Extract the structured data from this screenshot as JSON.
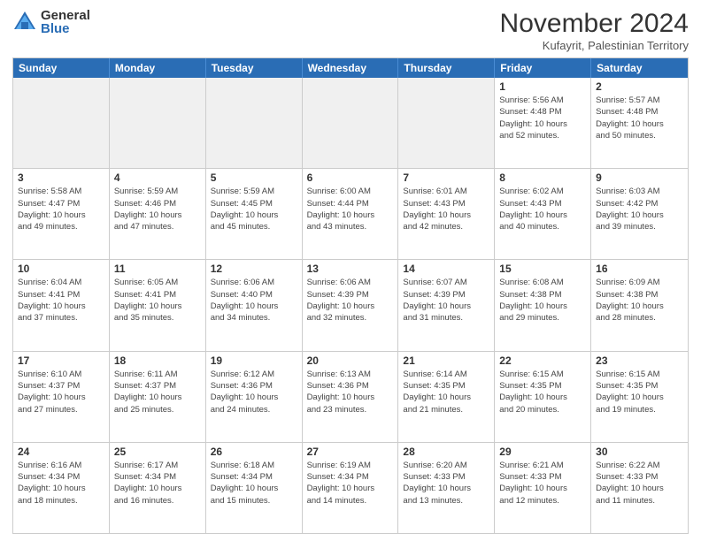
{
  "logo": {
    "general": "General",
    "blue": "Blue"
  },
  "header": {
    "month": "November 2024",
    "location": "Kufayrit, Palestinian Territory"
  },
  "weekdays": [
    "Sunday",
    "Monday",
    "Tuesday",
    "Wednesday",
    "Thursday",
    "Friday",
    "Saturday"
  ],
  "rows": [
    [
      {
        "day": "",
        "info": ""
      },
      {
        "day": "",
        "info": ""
      },
      {
        "day": "",
        "info": ""
      },
      {
        "day": "",
        "info": ""
      },
      {
        "day": "",
        "info": ""
      },
      {
        "day": "1",
        "info": "Sunrise: 5:56 AM\nSunset: 4:48 PM\nDaylight: 10 hours\nand 52 minutes."
      },
      {
        "day": "2",
        "info": "Sunrise: 5:57 AM\nSunset: 4:48 PM\nDaylight: 10 hours\nand 50 minutes."
      }
    ],
    [
      {
        "day": "3",
        "info": "Sunrise: 5:58 AM\nSunset: 4:47 PM\nDaylight: 10 hours\nand 49 minutes."
      },
      {
        "day": "4",
        "info": "Sunrise: 5:59 AM\nSunset: 4:46 PM\nDaylight: 10 hours\nand 47 minutes."
      },
      {
        "day": "5",
        "info": "Sunrise: 5:59 AM\nSunset: 4:45 PM\nDaylight: 10 hours\nand 45 minutes."
      },
      {
        "day": "6",
        "info": "Sunrise: 6:00 AM\nSunset: 4:44 PM\nDaylight: 10 hours\nand 43 minutes."
      },
      {
        "day": "7",
        "info": "Sunrise: 6:01 AM\nSunset: 4:43 PM\nDaylight: 10 hours\nand 42 minutes."
      },
      {
        "day": "8",
        "info": "Sunrise: 6:02 AM\nSunset: 4:43 PM\nDaylight: 10 hours\nand 40 minutes."
      },
      {
        "day": "9",
        "info": "Sunrise: 6:03 AM\nSunset: 4:42 PM\nDaylight: 10 hours\nand 39 minutes."
      }
    ],
    [
      {
        "day": "10",
        "info": "Sunrise: 6:04 AM\nSunset: 4:41 PM\nDaylight: 10 hours\nand 37 minutes."
      },
      {
        "day": "11",
        "info": "Sunrise: 6:05 AM\nSunset: 4:41 PM\nDaylight: 10 hours\nand 35 minutes."
      },
      {
        "day": "12",
        "info": "Sunrise: 6:06 AM\nSunset: 4:40 PM\nDaylight: 10 hours\nand 34 minutes."
      },
      {
        "day": "13",
        "info": "Sunrise: 6:06 AM\nSunset: 4:39 PM\nDaylight: 10 hours\nand 32 minutes."
      },
      {
        "day": "14",
        "info": "Sunrise: 6:07 AM\nSunset: 4:39 PM\nDaylight: 10 hours\nand 31 minutes."
      },
      {
        "day": "15",
        "info": "Sunrise: 6:08 AM\nSunset: 4:38 PM\nDaylight: 10 hours\nand 29 minutes."
      },
      {
        "day": "16",
        "info": "Sunrise: 6:09 AM\nSunset: 4:38 PM\nDaylight: 10 hours\nand 28 minutes."
      }
    ],
    [
      {
        "day": "17",
        "info": "Sunrise: 6:10 AM\nSunset: 4:37 PM\nDaylight: 10 hours\nand 27 minutes."
      },
      {
        "day": "18",
        "info": "Sunrise: 6:11 AM\nSunset: 4:37 PM\nDaylight: 10 hours\nand 25 minutes."
      },
      {
        "day": "19",
        "info": "Sunrise: 6:12 AM\nSunset: 4:36 PM\nDaylight: 10 hours\nand 24 minutes."
      },
      {
        "day": "20",
        "info": "Sunrise: 6:13 AM\nSunset: 4:36 PM\nDaylight: 10 hours\nand 23 minutes."
      },
      {
        "day": "21",
        "info": "Sunrise: 6:14 AM\nSunset: 4:35 PM\nDaylight: 10 hours\nand 21 minutes."
      },
      {
        "day": "22",
        "info": "Sunrise: 6:15 AM\nSunset: 4:35 PM\nDaylight: 10 hours\nand 20 minutes."
      },
      {
        "day": "23",
        "info": "Sunrise: 6:15 AM\nSunset: 4:35 PM\nDaylight: 10 hours\nand 19 minutes."
      }
    ],
    [
      {
        "day": "24",
        "info": "Sunrise: 6:16 AM\nSunset: 4:34 PM\nDaylight: 10 hours\nand 18 minutes."
      },
      {
        "day": "25",
        "info": "Sunrise: 6:17 AM\nSunset: 4:34 PM\nDaylight: 10 hours\nand 16 minutes."
      },
      {
        "day": "26",
        "info": "Sunrise: 6:18 AM\nSunset: 4:34 PM\nDaylight: 10 hours\nand 15 minutes."
      },
      {
        "day": "27",
        "info": "Sunrise: 6:19 AM\nSunset: 4:34 PM\nDaylight: 10 hours\nand 14 minutes."
      },
      {
        "day": "28",
        "info": "Sunrise: 6:20 AM\nSunset: 4:33 PM\nDaylight: 10 hours\nand 13 minutes."
      },
      {
        "day": "29",
        "info": "Sunrise: 6:21 AM\nSunset: 4:33 PM\nDaylight: 10 hours\nand 12 minutes."
      },
      {
        "day": "30",
        "info": "Sunrise: 6:22 AM\nSunset: 4:33 PM\nDaylight: 10 hours\nand 11 minutes."
      }
    ]
  ]
}
